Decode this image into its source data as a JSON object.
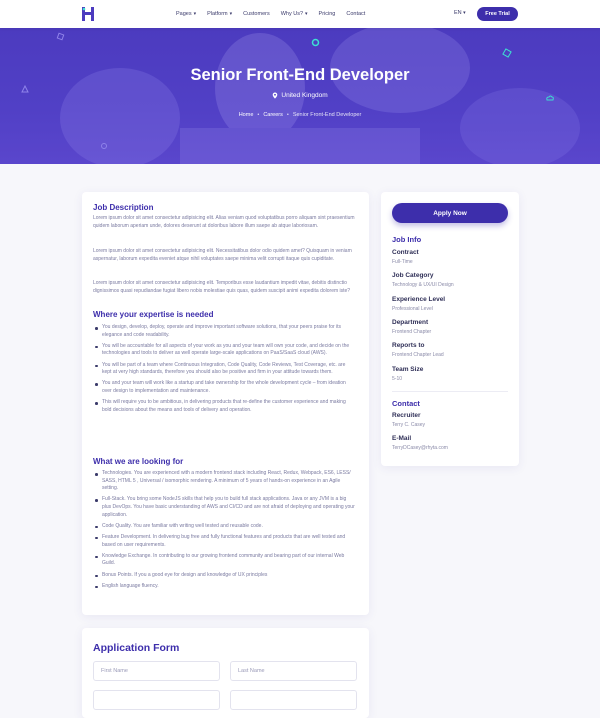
{
  "nav": {
    "menu": [
      {
        "label": "Pages",
        "dropdown": true
      },
      {
        "label": "Platform",
        "dropdown": true
      },
      {
        "label": "Customers",
        "dropdown": false
      },
      {
        "label": "Why Us?",
        "dropdown": true
      },
      {
        "label": "Pricing",
        "dropdown": false
      },
      {
        "label": "Contact",
        "dropdown": false
      }
    ],
    "lang": "EN",
    "trial_label": "Free Trial"
  },
  "hero": {
    "title": "Senior Front-End Developer",
    "location": "United Kingdom",
    "breadcrumb": [
      "Home",
      "Careers",
      "Senior Front-End Developer"
    ]
  },
  "job": {
    "description_heading": "Job Description",
    "description": [
      "Lorem ipsum dolor sit amet consectetur adipisicing elit. Alias veniam quod voluptatibus porro aliquam sint praesentium quidem laborum aperiam unde, dolores deserunt at doloribus labore illum saepe ab atque laboriosam.",
      "Lorem ipsum dolor sit amet consectetur adipisicing elit. Necessitatibus dolor odio quidem amet? Quisquam in veniam aspernatur, laborum expedita eveniet atque nihil voluptates saepe minima velit corrupti itaque quis cupiditate.",
      "Lorem ipsum dolor sit amet consectetur adipisicing elit. Temporibus esse laudantium impedit vitae, debitis distinctio dignissimos quasi repudiandae fugiat libero nobis molestiae quis quas, quidem suscipit animi expedita dolorem iste?"
    ],
    "expertise_heading": "Where your expertise is needed",
    "expertise": [
      "You design, develop, deploy, operate and improve important software solutions, that your peers praise for its elegance and code readability.",
      "You will be accountable for all aspects of your work as you and your team will own your code, and decide on the technologies and tools to deliver as well operate large-scale applications on PaaS/SaaS cloud (AWS).",
      "You will be part of a team where Continuous Integration, Code Quality, Code Reviews, Test Coverage, etc. are kept at very high standards, therefore you should also be positive and firm in your attitude towards them.",
      "You and your team will work like a startup and take ownership for the whole development cycle – from ideation over design to implementation and maintenance.",
      "This will require you to be ambitious, in delivering products that re-define the customer experience and making bold decisions about the means and tools of delivery and operation."
    ],
    "looking_heading": "What we are looking for",
    "looking": [
      "Technologies. You are experienced with a modern frontend stack including React, Redux, Webpack, ES6, LESS/ SASS, HTML 5 , Universal / isomorphic rendering. A minimum of 5 years of hands-on experience in an Agile setting.",
      "Full-Stack. You bring some NodeJS skills that help you to build full stack applications. Java or any JVM is a big plus DevOps. You have basic understanding of AWS and CI/CD and are not afraid of deploying and operating your application.",
      "Code Quality. You are familiar with writing well tested and reusable code.",
      "Feature Development. In delivering bug free and fully functional features and products that are well tested and based on user requirements.",
      "Knowledge Exchange. In contributing to our growing frontend community and bearing part of our internal Web Guild.",
      "Bonus Points. If you a good eye for design and knowledge of UX principles",
      "English language fluency."
    ]
  },
  "sidebar": {
    "apply_label": "Apply Now",
    "info_heading": "Job Info",
    "info": [
      {
        "label": "Contract",
        "value": "Full-Time"
      },
      {
        "label": "Job Category",
        "value": "Technology & UX/UI Design"
      },
      {
        "label": "Experience Level",
        "value": "Professional Level"
      },
      {
        "label": "Department",
        "value": "Frontend Chapter"
      },
      {
        "label": "Reports to",
        "value": "Frontend Chapter Lead"
      },
      {
        "label": "Team Size",
        "value": "5-10"
      }
    ],
    "contact_heading": "Contact",
    "contact": [
      {
        "label": "Recruiter",
        "value": "Terry C. Casey"
      },
      {
        "label": "E-Mail",
        "value": "TerryDCasey@rhyta.com"
      }
    ]
  },
  "form": {
    "title": "Application Form",
    "first_name_placeholder": "First Name",
    "last_name_placeholder": "Last Name"
  },
  "colors": {
    "primary": "#3d2eab",
    "hero": "#5140c6",
    "accent_teal": "#3de0d2"
  }
}
